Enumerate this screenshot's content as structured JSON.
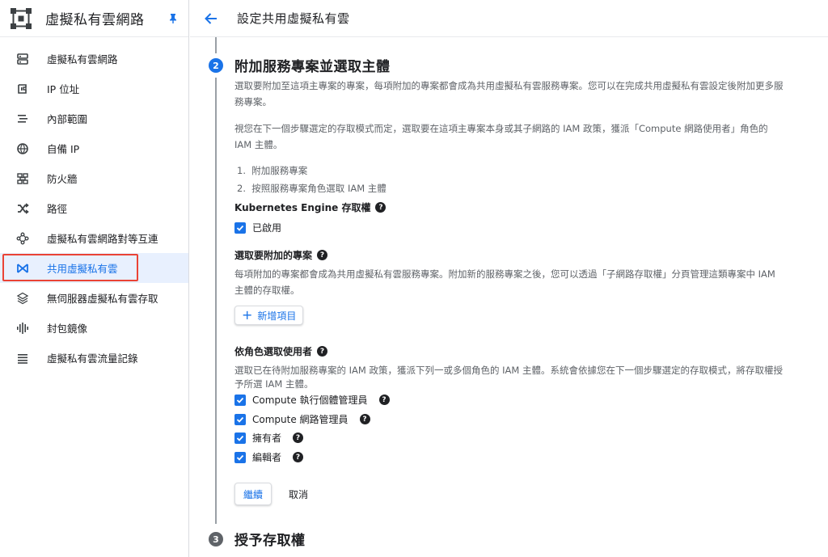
{
  "sidebar": {
    "title": "虛擬私有雲網路",
    "items": [
      {
        "label": "虛擬私有雲網路",
        "icon": "vpc-networks-icon"
      },
      {
        "label": "IP 位址",
        "icon": "ip-address-icon"
      },
      {
        "label": "內部範圍",
        "icon": "internal-ranges-icon"
      },
      {
        "label": "自備 IP",
        "icon": "byoip-icon"
      },
      {
        "label": "防火牆",
        "icon": "firewall-icon"
      },
      {
        "label": "路徑",
        "icon": "routes-icon"
      },
      {
        "label": "虛擬私有雲網路對等互連",
        "icon": "vpc-peering-icon"
      },
      {
        "label": "共用虛擬私有雲",
        "icon": "shared-vpc-icon",
        "active": true
      },
      {
        "label": "無伺服器虛擬私有雲存取",
        "icon": "serverless-vpc-icon"
      },
      {
        "label": "封包鏡像",
        "icon": "packet-mirroring-icon"
      },
      {
        "label": "虛擬私有雲流量記錄",
        "icon": "flow-logs-icon"
      }
    ]
  },
  "header": {
    "title": "設定共用虛擬私有雲"
  },
  "step2": {
    "number": "2",
    "title": "附加服務專案並選取主體",
    "desc1": "選取要附加至這項主專案的專案，每項附加的專案都會成為共用虛擬私有雲服務專案。您可以在完成共用虛擬私有雲設定後附加更多服務專案。",
    "desc2": "視您在下一個步驟選定的存取模式而定，選取要在這項主專案本身或其子網路的 IAM 政策，獲派「Compute 網路使用者」角色的 IAM 主體。",
    "list": [
      "附加服務專案",
      "按照服務專案角色選取 IAM 主體"
    ],
    "gke_label": "Kubernetes Engine 存取權",
    "gke_checkbox": "已啟用",
    "attach_label": "選取要附加的專案",
    "attach_desc": "每項附加的專案都會成為共用虛擬私有雲服務專案。附加新的服務專案之後，您可以透過「子網路存取權」分頁管理這類專案中 IAM 主體的存取權。",
    "add_button": "新增項目",
    "role_label": "依角色選取使用者",
    "role_desc": "選取已在待附加服務專案的 IAM 政策，獲派下列一或多個角色的 IAM 主體。系統會依據您在下一個步驟選定的存取模式，將存取權授予所選 IAM 主體。",
    "roles": [
      "Compute 執行個體管理員",
      "Compute 網路管理員",
      "擁有者",
      "編輯者"
    ],
    "continue_button": "繼續",
    "cancel_button": "取消"
  },
  "step3": {
    "number": "3",
    "title": "授予存取權"
  },
  "colors": {
    "accent": "#1a73e8",
    "highlight": "#ea4335",
    "inactive_step": "#5f6368"
  }
}
